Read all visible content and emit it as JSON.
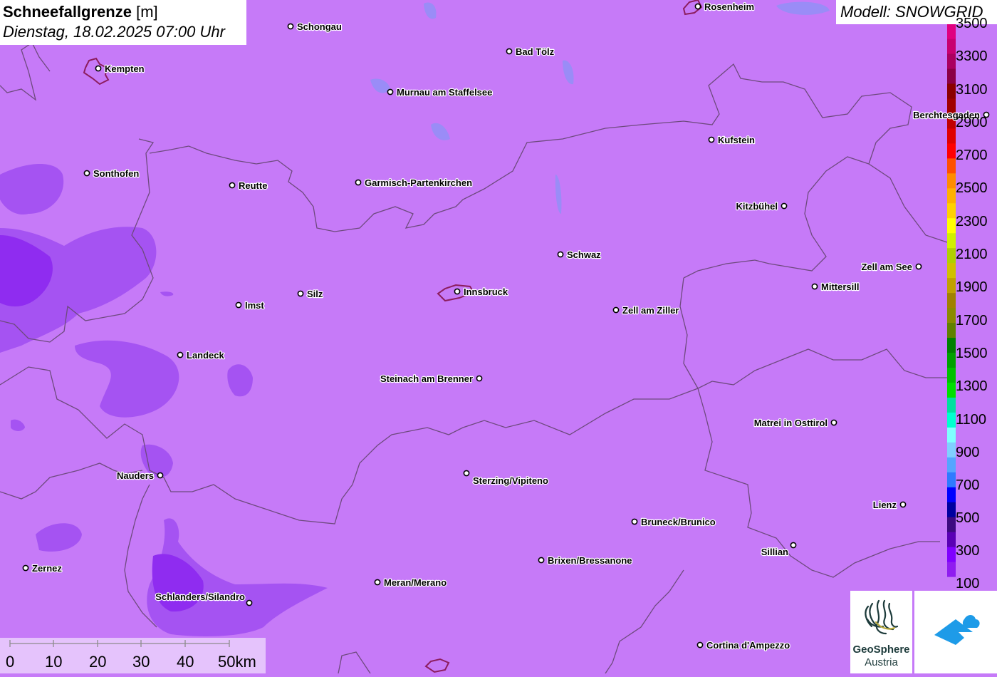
{
  "header": {
    "title_bold": "Schneefallgrenze",
    "title_unit": "[m]",
    "datetime": "Dienstag, 18.02.2025 07:00 Uhr"
  },
  "model": "Modell: SNOWGRID",
  "legend": {
    "colors": [
      "#c67af8",
      "#8f1cf0",
      "#7f00ff",
      "#5a00b5",
      "#3d0a80",
      "#0000a0",
      "#0000ff",
      "#2f7aff",
      "#55a5ff",
      "#80cfff",
      "#7fffff",
      "#00ffd0",
      "#00e0a0",
      "#00e000",
      "#00c000",
      "#00a000",
      "#008000",
      "#608000",
      "#8a8a00",
      "#a08000",
      "#c0a000",
      "#d0c000",
      "#b0d000",
      "#d0f000",
      "#ffff00",
      "#ffd000",
      "#ffb000",
      "#ff8c00",
      "#ff5000",
      "#ff0000",
      "#e00000",
      "#c00000",
      "#a00000",
      "#8b0000",
      "#8b0045",
      "#aa0060",
      "#c80070",
      "#e00080"
    ],
    "labels": [
      "100",
      "300",
      "500",
      "700",
      "900",
      "1100",
      "1300",
      "1500",
      "1700",
      "1900",
      "2100",
      "2300",
      "2500",
      "2700",
      "2900",
      "3100",
      "3300",
      "3500"
    ]
  },
  "scale_bar": {
    "labels": [
      "0",
      "10",
      "20",
      "30",
      "40",
      "50km"
    ]
  },
  "logos": {
    "geosphere_line1": "GeoSphere",
    "geosphere_line2": "Austria"
  },
  "cities": [
    {
      "name": "Rosenheim"
    },
    {
      "name": "Schongau"
    },
    {
      "name": "Bad Tölz"
    },
    {
      "name": "Kempten"
    },
    {
      "name": "Murnau am Staffelsee"
    },
    {
      "name": "Berchtesgaden"
    },
    {
      "name": "Kufstein"
    },
    {
      "name": "Sonthofen"
    },
    {
      "name": "Reutte"
    },
    {
      "name": "Garmisch-Partenkirchen"
    },
    {
      "name": "Kitzbühel"
    },
    {
      "name": "Schwaz"
    },
    {
      "name": "Zell am See"
    },
    {
      "name": "Mittersill"
    },
    {
      "name": "Innsbruck"
    },
    {
      "name": "Silz"
    },
    {
      "name": "Imst"
    },
    {
      "name": "Zell am Ziller"
    },
    {
      "name": "Landeck"
    },
    {
      "name": "Steinach am Brenner"
    },
    {
      "name": "Matrei in Osttirol"
    },
    {
      "name": "Nauders"
    },
    {
      "name": "Sterzing/Vipiteno"
    },
    {
      "name": "Lienz"
    },
    {
      "name": "Bruneck/Brunico"
    },
    {
      "name": "Sillian"
    },
    {
      "name": "Brixen/Bressanone"
    },
    {
      "name": "Zernez"
    },
    {
      "name": "Meran/Merano"
    },
    {
      "name": "Schlanders/Silandro"
    },
    {
      "name": "Cortina d'Ampezzo"
    }
  ]
}
